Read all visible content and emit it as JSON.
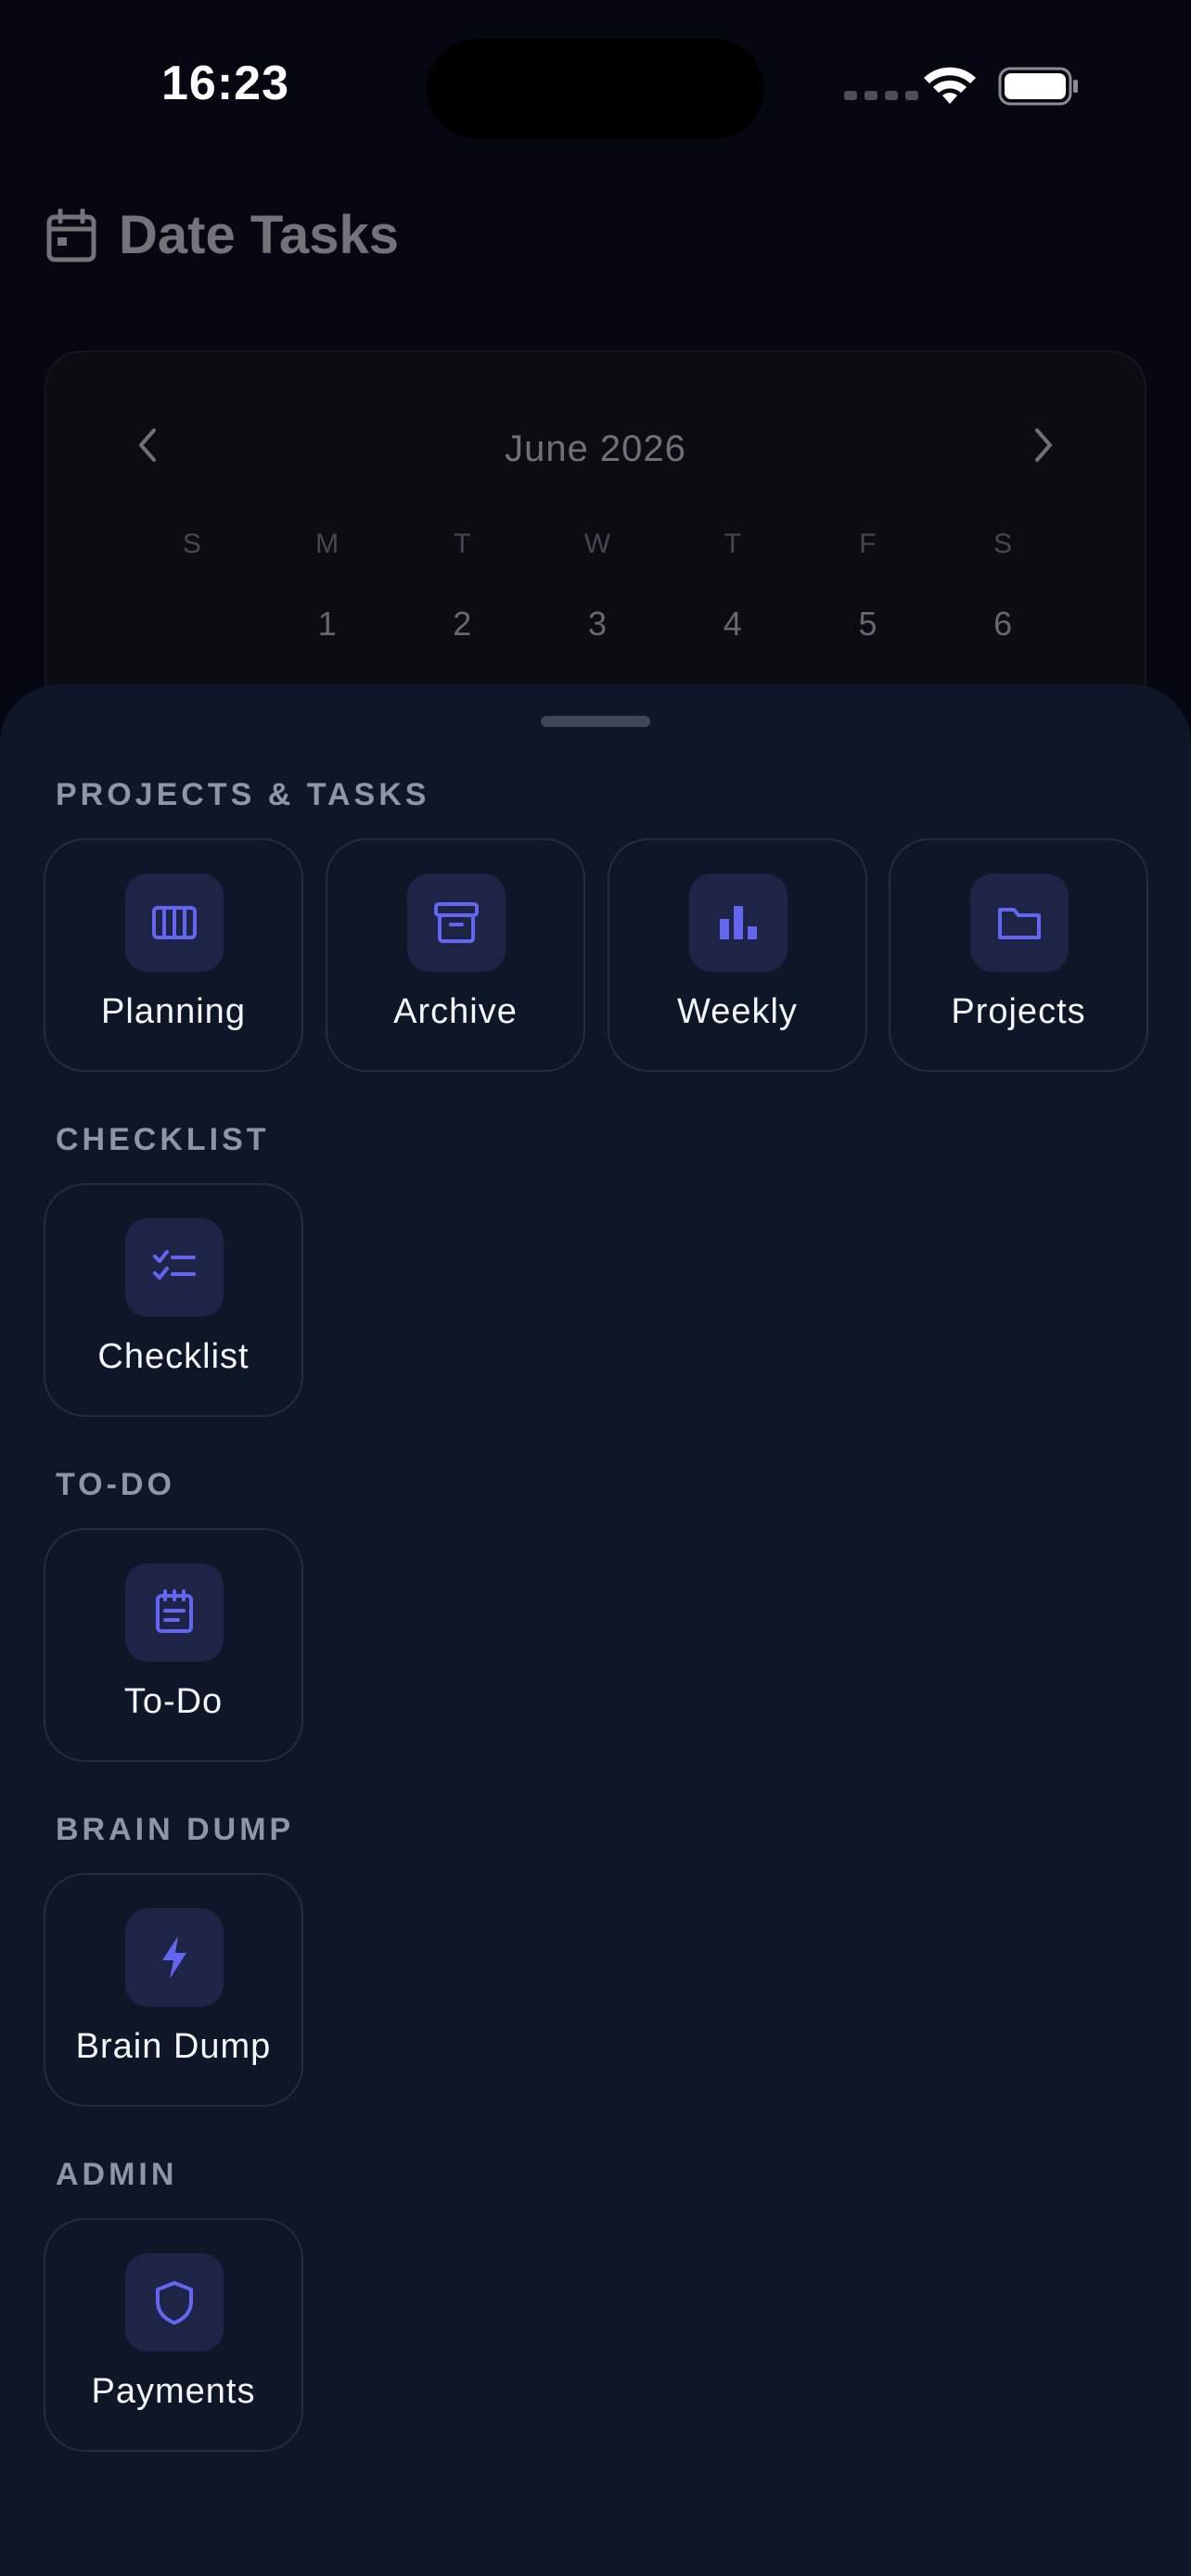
{
  "status_bar": {
    "time": "16:23"
  },
  "header": {
    "title": "Date Tasks",
    "icon": "calendar-icon"
  },
  "calendar": {
    "month": "June 2026",
    "weekdays": [
      "S",
      "M",
      "T",
      "W",
      "T",
      "F",
      "S"
    ],
    "first_row": [
      "",
      "1",
      "2",
      "3",
      "4",
      "5",
      "6"
    ]
  },
  "sheet": {
    "sections": [
      {
        "title": "PROJECTS & TASKS",
        "tiles": [
          {
            "label": "Planning",
            "icon": "columns-icon"
          },
          {
            "label": "Archive",
            "icon": "archive-box-icon"
          },
          {
            "label": "Weekly",
            "icon": "bar-chart-icon"
          },
          {
            "label": "Projects",
            "icon": "folder-icon"
          }
        ]
      },
      {
        "title": "CHECKLIST",
        "tiles": [
          {
            "label": "Checklist",
            "icon": "checklist-icon"
          }
        ]
      },
      {
        "title": "TO-DO",
        "tiles": [
          {
            "label": "To-Do",
            "icon": "notepad-icon"
          }
        ]
      },
      {
        "title": "BRAIN DUMP",
        "tiles": [
          {
            "label": "Brain Dump",
            "icon": "lightning-icon"
          }
        ]
      },
      {
        "title": "ADMIN",
        "tiles": [
          {
            "label": "Payments",
            "icon": "shield-icon"
          }
        ]
      }
    ]
  },
  "colors": {
    "accent": "#6366f1",
    "sheet_bg": "#0f1627",
    "tile_icon_bg": "#1e2446"
  }
}
